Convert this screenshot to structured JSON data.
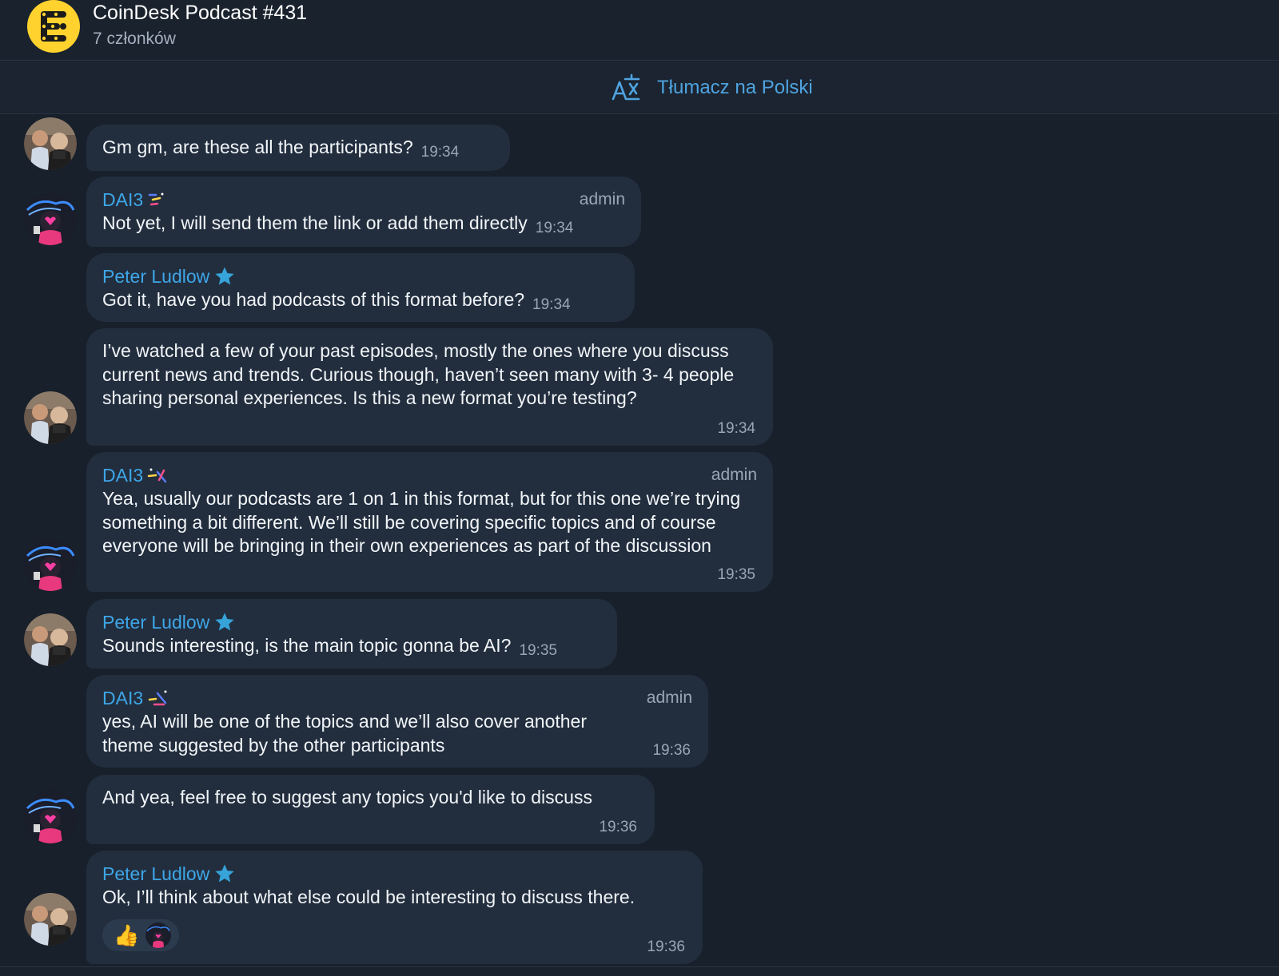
{
  "header": {
    "title": "CoinDesk Podcast #431",
    "subtitle": "7 członków"
  },
  "translate": {
    "label": "Tłumacz na Polski"
  },
  "messages": [
    {
      "sender": "",
      "text": "Gm gm, are these all the participants?",
      "time": "19:34",
      "avatar": "peter-avatar"
    },
    {
      "sender": "DAI3",
      "role": "admin",
      "text": "Not yet, I will send them the link or add them directly",
      "time": "19:34",
      "avatar": "dai3-avatar"
    },
    {
      "sender": "Peter Ludlow",
      "text": "Got it, have you had podcasts of this format before?",
      "time": "19:34"
    },
    {
      "sender": "",
      "text": "I’ve watched a few of your past episodes, mostly the ones where you discuss current news and trends. Curious though, haven’t seen many with 3- 4 people sharing personal experiences. Is this a new format you’re testing?",
      "time": "19:34",
      "avatar": "peter-avatar"
    },
    {
      "sender": "DAI3",
      "role": "admin",
      "text": "Yea, usually our podcasts are 1 on 1 in this format, but for this one we’re trying something a bit different. We’ll still be covering specific topics and of course everyone will be bringing in their own experiences as part of the discussion",
      "time": "19:35",
      "avatar": "dai3-avatar"
    },
    {
      "sender": "Peter Ludlow",
      "text": "Sounds interesting, is the main topic gonna be AI?",
      "time": "19:35",
      "avatar": "peter-avatar"
    },
    {
      "sender": "DAI3",
      "role": "admin",
      "text": "yes, AI will be one of the topics and we’ll also cover another theme suggested by the other participants",
      "time": "19:36"
    },
    {
      "sender": "",
      "text": "And yea, feel free to suggest any topics you'd like to discuss",
      "time": "19:36",
      "avatar": "dai3-avatar"
    },
    {
      "sender": "Peter Ludlow",
      "text": "Ok, I’ll think about what else could be interesting to discuss there.",
      "time": "19:36",
      "reactions": [
        "👍"
      ],
      "avatar": "peter-avatar"
    }
  ],
  "colors": {
    "background": "#18202b",
    "bubble": "#222e3e",
    "accent": "#3ea6e8",
    "star": "#36a3d9"
  }
}
